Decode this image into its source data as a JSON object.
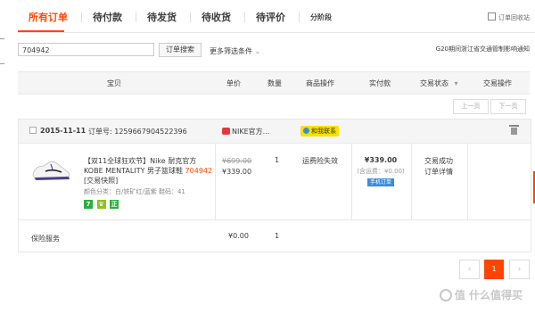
{
  "tabs": [
    {
      "label": "所有订单",
      "active": true
    },
    {
      "label": "待付款"
    },
    {
      "label": "待发货"
    },
    {
      "label": "待收货"
    },
    {
      "label": "待评价"
    },
    {
      "label": "分阶段"
    }
  ],
  "recycle_label": "订单回收站",
  "search": {
    "value": "704942",
    "button": "订单搜索",
    "more_filters": "更多筛选条件"
  },
  "notice": "G20期间浙江省交通管制影响通知",
  "table_headers": {
    "item": "宝贝",
    "unit_price": "单价",
    "quantity": "数量",
    "item_ops": "商品操作",
    "paid": "实付款",
    "trade_status": "交易状态",
    "trade_ops": "交易操作"
  },
  "pager_top": {
    "prev": "上一页",
    "next": "下一页"
  },
  "order": {
    "date": "2015-11-11",
    "order_no": "订单号: 1259667904522396",
    "shop": "NIKE官方...",
    "contact": "和我联系",
    "product": {
      "title_a": "【双11全球狂欢节】Nike 耐克官方 KOBE MENTALITY 男子篮球鞋 ",
      "title_price": "704942",
      "title_b": " [交易快照]",
      "attrs": "颜色分类：白/铁矿红/蓝紫  鞋码：41",
      "badges": [
        {
          "text": "7",
          "color": "#2cae3f"
        },
        {
          "text": "♛",
          "color": "#8dc21f"
        },
        {
          "text": "正",
          "color": "#2cae3f"
        }
      ],
      "original_price": "¥699.00",
      "price": "¥339.00",
      "quantity": "1",
      "aftersale": "运费险失效"
    },
    "paid_amount": "¥339.00",
    "shipping": "(含运费：¥0.00)",
    "phone_order": "手机订单",
    "status": "交易成功",
    "detail": "订单详情",
    "insurance": {
      "label": "保险服务",
      "price": "¥0.00",
      "quantity": "1"
    }
  },
  "pager_bottom": {
    "prev": "‹",
    "current": "1",
    "next": "›"
  },
  "watermark": "值 什么值得买"
}
